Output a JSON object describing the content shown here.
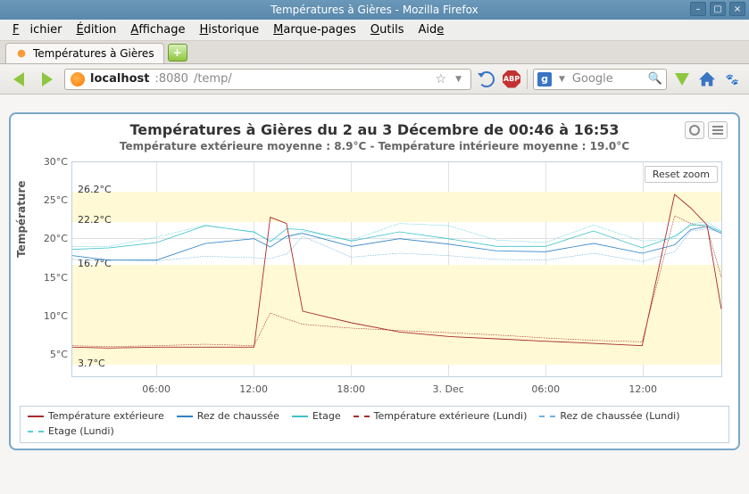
{
  "window": {
    "title": "Températures à Gières - Mozilla Firefox"
  },
  "menu": {
    "file": "Fichier",
    "edit": "Édition",
    "view": "Affichage",
    "history": "Historique",
    "bookmarks": "Marque-pages",
    "tools": "Outils",
    "help": "Aide"
  },
  "tab": {
    "title": "Températures à Gières"
  },
  "url": {
    "host": "localhost",
    "port": ":8080",
    "path": "/temp/"
  },
  "search": {
    "placeholder": "Google",
    "engine_glyph": "g"
  },
  "abp_label": "ABP",
  "chart": {
    "title": "Températures à Gières du 2 au 3 Décembre de 00:46 à 16:53",
    "subtitle": "Température extérieure moyenne : 8.9°C - Température intérieure moyenne : 19.0°C",
    "yaxis": "Température",
    "reset": "Reset zoom",
    "annotations": {
      "a1": "26.2°C",
      "a2": "22.2°C",
      "a3": "16.7°C",
      "a4": "3.7°C"
    },
    "yticks": {
      "t30": "30°C",
      "t25": "25°C",
      "t20": "20°C",
      "t15": "15°C",
      "t10": "10°C",
      "t5": "5°C"
    },
    "xticks": {
      "t1": "06:00",
      "t2": "12:00",
      "t3": "18:00",
      "t4": "3. Dec",
      "t5": "06:00",
      "t6": "12:00"
    }
  },
  "legend": {
    "l1": "Température extérieure",
    "l2": "Rez de chaussée",
    "l3": "Etage",
    "l4": "Température extérieure (Lundi)",
    "l5": "Rez de chaussée (Lundi)",
    "l6": "Etage (Lundi)"
  },
  "colors": {
    "ext": "#a82c2c",
    "rdc": "#2d82c6",
    "etage": "#3fc1c9",
    "ext_l": "#a82c2c",
    "rdc_l": "#6fb0e0",
    "etage_l": "#55cfd6",
    "band": "#fff9d6"
  },
  "chart_data": {
    "type": "line",
    "title": "Températures à Gières du 2 au 3 Décembre de 00:46 à 16:53",
    "xlabel": "",
    "ylabel": "Température",
    "xlim": [
      "2 Dec 00:46",
      "3 Dec 16:53"
    ],
    "ylim": [
      2,
      30
    ],
    "yticks": [
      5,
      10,
      15,
      20,
      25,
      30
    ],
    "x": [
      "00:46",
      "03:00",
      "06:00",
      "09:00",
      "12:00",
      "13:00",
      "14:00",
      "15:00",
      "18:00",
      "21:00",
      "3 Dec 00:00",
      "03:00",
      "06:00",
      "09:00",
      "12:00",
      "14:00",
      "15:00",
      "16:00",
      "16:53"
    ],
    "series": [
      {
        "name": "Température extérieure",
        "color": "#a82c2c",
        "style": "solid",
        "values": [
          5.8,
          5.7,
          5.8,
          5.8,
          5.8,
          22.8,
          22.0,
          10.5,
          9.0,
          7.8,
          7.2,
          6.9,
          6.6,
          6.3,
          6.0,
          25.8,
          24.0,
          21.8,
          10.8
        ]
      },
      {
        "name": "Rez de chaussée",
        "color": "#2d82c6",
        "style": "solid",
        "values": [
          17.8,
          17.2,
          17.2,
          19.4,
          20.0,
          18.9,
          20.3,
          20.7,
          19.0,
          20.0,
          19.3,
          18.4,
          18.3,
          19.4,
          18.1,
          19.2,
          21.2,
          21.6,
          20.7
        ]
      },
      {
        "name": "Etage",
        "color": "#3fc1c9",
        "style": "solid",
        "values": [
          18.6,
          18.8,
          19.5,
          21.7,
          20.9,
          19.6,
          21.3,
          21.2,
          19.7,
          20.9,
          20.0,
          19.0,
          19.0,
          21.0,
          18.8,
          20.3,
          21.8,
          21.8,
          20.9
        ]
      },
      {
        "name": "Température extérieure (Lundi)",
        "color": "#a82c2c",
        "style": "dashed",
        "values": [
          6.0,
          5.9,
          6.0,
          6.2,
          6.0,
          10.3,
          9.5,
          8.8,
          8.3,
          8.0,
          7.7,
          7.4,
          7.0,
          6.7,
          6.5,
          23.0,
          22.0,
          21.5,
          15.0
        ]
      },
      {
        "name": "Rez de chaussée (Lundi)",
        "color": "#6fb0e0",
        "style": "dashed",
        "values": [
          17.3,
          17.2,
          17.1,
          17.7,
          17.5,
          17.4,
          18.0,
          20.3,
          17.6,
          18.1,
          17.8,
          17.3,
          17.2,
          18.1,
          17.0,
          18.3,
          21.0,
          21.3,
          20.8
        ]
      },
      {
        "name": "Etage (Lundi)",
        "color": "#55cfd6",
        "style": "dashed",
        "values": [
          19.0,
          19.0,
          20.2,
          21.8,
          20.8,
          19.8,
          20.0,
          21.0,
          19.8,
          22.0,
          21.7,
          19.8,
          19.5,
          21.8,
          19.7,
          20.0,
          22.0,
          22.2,
          21.0
        ]
      }
    ],
    "annotations": [
      {
        "text": "26.2°C",
        "x": "early",
        "y": 26.2
      },
      {
        "text": "22.2°C",
        "x": "early",
        "y": 22.2
      },
      {
        "text": "16.7°C",
        "x": "early",
        "y": 16.7
      },
      {
        "text": "3.7°C",
        "x": "early",
        "y": 3.7
      }
    ],
    "plot_bands": [
      {
        "from": 3.7,
        "to": 16.7
      },
      {
        "from": 22.2,
        "to": 26.2
      }
    ]
  }
}
